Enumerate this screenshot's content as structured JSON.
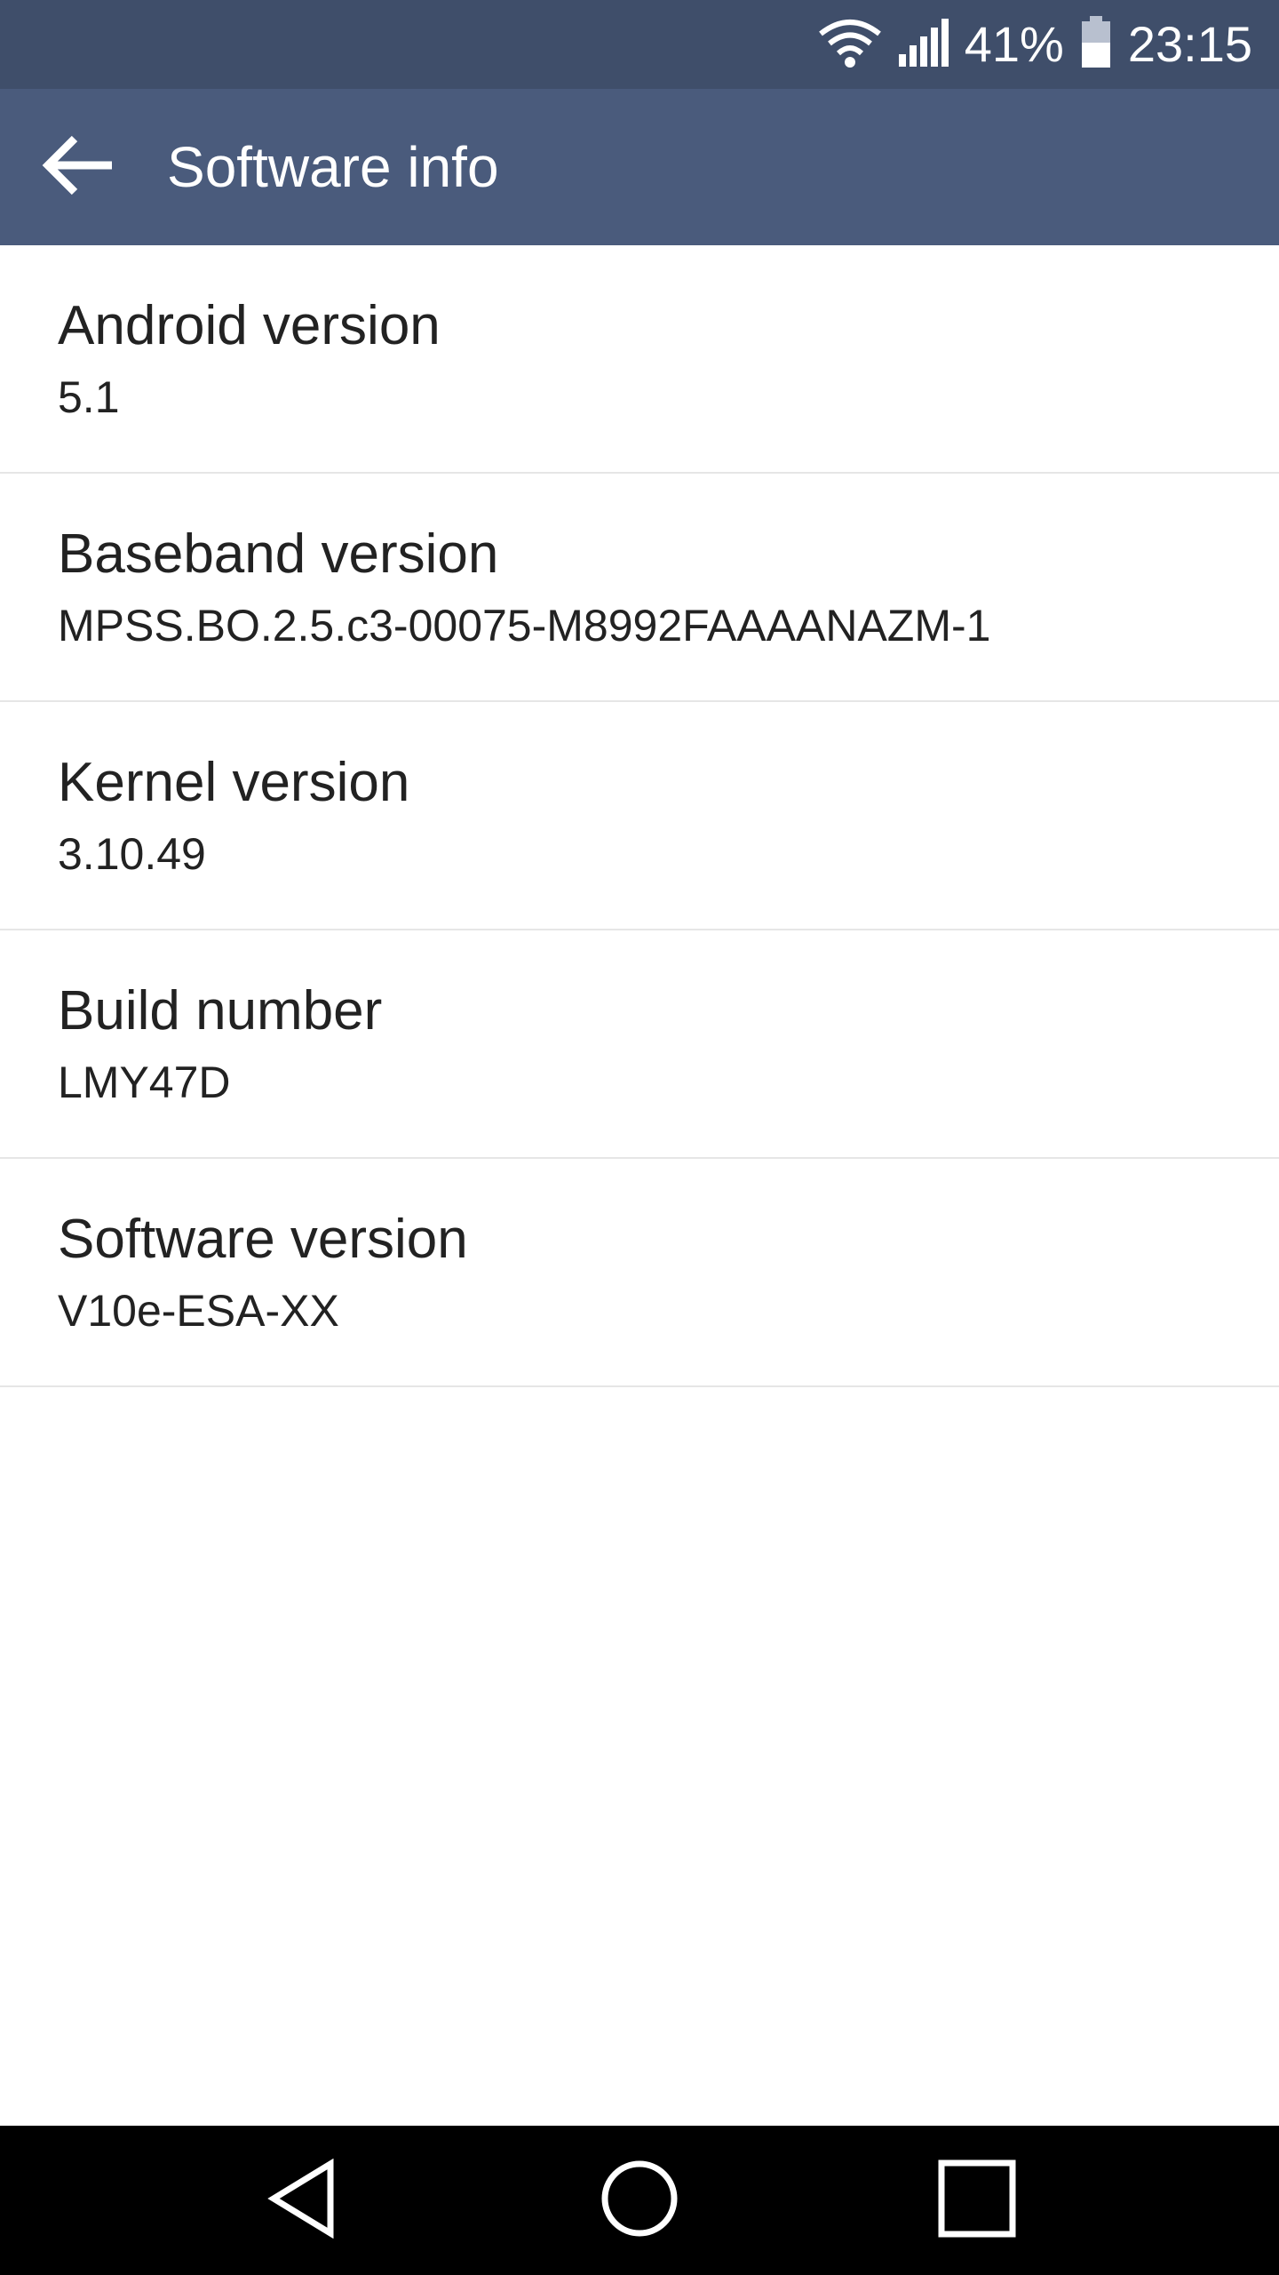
{
  "status_bar": {
    "battery_percent": "41%",
    "time": "23:15",
    "icons": [
      "wifi-icon",
      "cell-signal-icon",
      "battery-icon"
    ]
  },
  "app_bar": {
    "title": "Software info",
    "back_icon": "arrow-left-icon"
  },
  "items": [
    {
      "title": "Android version",
      "value": "5.1"
    },
    {
      "title": "Baseband version",
      "value": "MPSS.BO.2.5.c3-00075-M8992FAAAANAZM-1"
    },
    {
      "title": "Kernel version",
      "value": "3.10.49"
    },
    {
      "title": "Build number",
      "value": "LMY47D"
    },
    {
      "title": "Software version",
      "value": "V10e-ESA-XX"
    }
  ],
  "nav_bar": {
    "buttons": [
      "back-triangle-icon",
      "home-circle-icon",
      "recents-square-icon"
    ]
  },
  "colors": {
    "status_bar": "#3f4e6a",
    "app_bar": "#4a5b7c",
    "nav_bar": "#000000",
    "background": "#ffffff",
    "divider": "#e6e6e6"
  }
}
